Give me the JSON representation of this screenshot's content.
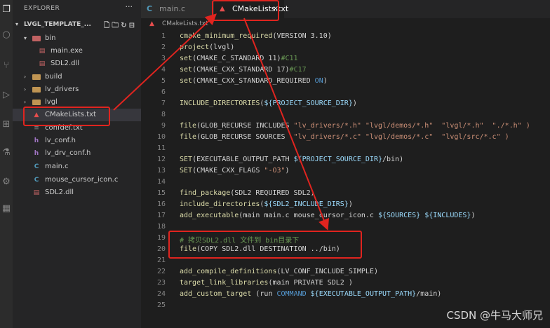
{
  "explorer": {
    "title": "EXPLORER",
    "more": "···",
    "root": "LVGL_TEMPLATE_..."
  },
  "tree": [
    {
      "label": "bin",
      "type": "folder-open",
      "icon": "bin-folder-icon"
    },
    {
      "label": "main.exe",
      "type": "file",
      "icon": "exe-file-icon"
    },
    {
      "label": "SDL2.dll",
      "type": "file",
      "icon": "dll-file-icon"
    },
    {
      "label": "build",
      "type": "folder",
      "icon": "folder-icon"
    },
    {
      "label": "lv_drivers",
      "type": "folder",
      "icon": "folder-icon"
    },
    {
      "label": "lvgl",
      "type": "folder",
      "icon": "folder-icon"
    },
    {
      "label": "CMakeLists.txt",
      "type": "file",
      "icon": "cmake-icon"
    },
    {
      "label": "confdef.txt",
      "type": "file",
      "icon": "text-file-icon"
    },
    {
      "label": "lv_conf.h",
      "type": "file",
      "icon": "h-file-icon"
    },
    {
      "label": "lv_drv_conf.h",
      "type": "file",
      "icon": "h-file-icon"
    },
    {
      "label": "main.c",
      "type": "file",
      "icon": "c-file-icon"
    },
    {
      "label": "mouse_cursor_icon.c",
      "type": "file",
      "icon": "c-file-icon"
    },
    {
      "label": "SDL2.dll",
      "type": "file",
      "icon": "dll-file-icon"
    }
  ],
  "tabs": [
    {
      "label": "main.c",
      "icon": "C"
    },
    {
      "label": "CMakeLists.txt",
      "icon": "▲",
      "close": "×"
    }
  ],
  "breadcrumb": "CMakeLists.txt",
  "code": {
    "line_numbers": [
      "1",
      "2",
      "3",
      "4",
      "5",
      "6",
      "7",
      "8",
      "9",
      "10",
      "11",
      "12",
      "13",
      "14",
      "15",
      "16",
      "17",
      "18",
      "19",
      "20",
      "21",
      "22",
      "23",
      "24",
      "25"
    ],
    "lines": {
      "l1": {
        "a": "cmake_minimum_required",
        "b": "(VERSION 3.10)"
      },
      "l2": {
        "a": "project",
        "b": "(lvgl)"
      },
      "l3": {
        "a": "set",
        "b": "(CMAKE_C_STANDARD 11)",
        "c": "#C11"
      },
      "l4": {
        "a": "set",
        "b": "(CMAKE_CXX_STANDARD 17)",
        "c": "#C17"
      },
      "l5": {
        "a": "set",
        "b": "(CMAKE_CXX_STANDARD_REQUIRED ",
        "c": "ON",
        ")": ")"
      },
      "l7": {
        "a": "INCLUDE_DIRECTORIES",
        "b": "(",
        "c": "${PROJECT_SOURCE_DIR}",
        ")": ")"
      },
      "l9": {
        "a": "file",
        "b": "(GLOB_RECURSE INCLUDES ",
        "c": "\"lv_drivers/*.h\" \"lvgl/demos/*.h\"  \"lvgl/*.h\"  \"./*.h\" )"
      },
      "l10": {
        "a": "file",
        "b": "(GLOB_RECURSE SOURCES  ",
        "c": "\"lv_drivers/*.c\" \"lvgl/demos/*.c\"  \"lvgl/src/*.c\" )"
      },
      "l12": {
        "a": "SET",
        "b": "(EXECUTABLE_OUTPUT_PATH ",
        "c": "${PROJECT_SOURCE_DIR}",
        "d": "/bin)"
      },
      "l13": {
        "a": "SET",
        "b": "(CMAKE_CXX_FLAGS ",
        "c": "\"-O3\"",
        ")": ")"
      },
      "l15": {
        "a": "find_package",
        "b": "(SDL2 REQUIRED SDL2)"
      },
      "l16": {
        "a": "include_directories",
        "b": "(",
        "c": "${SDL2_INCLUDE_DIRS}",
        ")": ")"
      },
      "l17": {
        "a": "add_executable",
        "b": "(main main.c mouse_cursor_icon.c ",
        "c": "${SOURCES} ${INCLUDES}",
        ")": ")"
      },
      "l19": {
        "a": "# 拷贝SDL2.dll 文件到 bin目录下"
      },
      "l20": {
        "a": "file",
        "b": "(COPY SDL2.dll DESTINATION ../bin)"
      },
      "l22": {
        "a": "add_compile_definitions",
        "b": "(LV_CONF_INCLUDE_SIMPLE)"
      },
      "l23": {
        "a": "target_link_libraries",
        "b": "(main PRIVATE SDL2 )"
      },
      "l24": {
        "a": "add_custom_target",
        "b": " (run ",
        "c": "COMMAND ",
        "d": "${EXECUTABLE_OUTPUT_PATH}",
        "e": "/main)"
      }
    }
  },
  "watermark": "CSDN @牛马大师兄",
  "colors": {
    "annotation": "#e0241f",
    "background": "#1e1e1e",
    "sidebar": "#252526"
  }
}
